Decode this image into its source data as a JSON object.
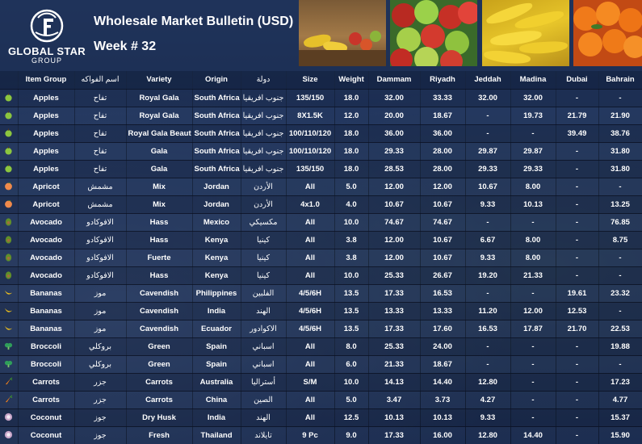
{
  "header": {
    "logo_name": "GLOBAL STAR",
    "logo_group": "GROUP",
    "title": "Wholesale Market Bulletin (USD)",
    "week": "Week # 32"
  },
  "columns": [
    "",
    "Item Group",
    "اسم الفواكه",
    "Variety",
    "Origin",
    "دولة",
    "Size",
    "Weight",
    "Dammam",
    "Riyadh",
    "Jeddah",
    "Madina",
    "Dubai",
    "Bahrain"
  ],
  "icon_colors": {
    "apple-icon": "#8cc63f",
    "apricot-icon": "#f08a4b",
    "avocado-icon": "#5f8f2a",
    "banana-icon": "#f2c21b",
    "broccoli-icon": "#2f9e5a",
    "carrot-icon": "#f07f1a",
    "coconut-icon": "#c9a6c9"
  },
  "rows": [
    {
      "icon": "apple-icon",
      "item": "Apples",
      "ar": "تفاح",
      "variety": "Royal Gala",
      "origin": "South Africa",
      "origin_ar": "جنوب افريقيا",
      "size": "135/150",
      "weight": "18.0",
      "dammam": "32.00",
      "riyadh": "33.33",
      "jeddah": "32.00",
      "madina": "32.00",
      "dubai": "-",
      "bahrain": "-"
    },
    {
      "icon": "apple-icon",
      "item": "Apples",
      "ar": "تفاح",
      "variety": "Royal Gala",
      "origin": "South Africa",
      "origin_ar": "جنوب افريقيا",
      "size": "8X1.5K",
      "weight": "12.0",
      "dammam": "20.00",
      "riyadh": "18.67",
      "jeddah": "-",
      "madina": "19.73",
      "dubai": "21.79",
      "bahrain": "21.90"
    },
    {
      "icon": "apple-icon",
      "item": "Apples",
      "ar": "تفاح",
      "variety": "Royal Gala Beaut",
      "origin": "South Africa",
      "origin_ar": "جنوب افريقيا",
      "size": "100/110/120",
      "weight": "18.0",
      "dammam": "36.00",
      "riyadh": "36.00",
      "jeddah": "-",
      "madina": "-",
      "dubai": "39.49",
      "bahrain": "38.76"
    },
    {
      "icon": "apple-icon",
      "item": "Apples",
      "ar": "تفاح",
      "variety": "Gala",
      "origin": "South Africa",
      "origin_ar": "جنوب افريقيا",
      "size": "100/110/120",
      "weight": "18.0",
      "dammam": "29.33",
      "riyadh": "28.00",
      "jeddah": "29.87",
      "madina": "29.87",
      "dubai": "-",
      "bahrain": "31.80"
    },
    {
      "icon": "apple-icon",
      "item": "Apples",
      "ar": "تفاح",
      "variety": "Gala",
      "origin": "South Africa",
      "origin_ar": "جنوب افريقيا",
      "size": "135/150",
      "weight": "18.0",
      "dammam": "28.53",
      "riyadh": "28.00",
      "jeddah": "29.33",
      "madina": "29.33",
      "dubai": "-",
      "bahrain": "31.80"
    },
    {
      "icon": "apricot-icon",
      "item": "Apricot",
      "ar": "مشمش",
      "variety": "Mix",
      "origin": "Jordan",
      "origin_ar": "الأردن",
      "size": "All",
      "weight": "5.0",
      "dammam": "12.00",
      "riyadh": "12.00",
      "jeddah": "10.67",
      "madina": "8.00",
      "dubai": "-",
      "bahrain": "-"
    },
    {
      "icon": "apricot-icon",
      "item": "Apricot",
      "ar": "مشمش",
      "variety": "Mix",
      "origin": "Jordan",
      "origin_ar": "الأردن",
      "size": "4x1.0",
      "weight": "4.0",
      "dammam": "10.67",
      "riyadh": "10.67",
      "jeddah": "9.33",
      "madina": "10.13",
      "dubai": "-",
      "bahrain": "13.25"
    },
    {
      "icon": "avocado-icon",
      "item": "Avocado",
      "ar": "الافوكادو",
      "variety": "Hass",
      "origin": "Mexico",
      "origin_ar": "مكسيكي",
      "size": "All",
      "weight": "10.0",
      "dammam": "74.67",
      "riyadh": "74.67",
      "jeddah": "-",
      "madina": "-",
      "dubai": "-",
      "bahrain": "76.85"
    },
    {
      "icon": "avocado-icon",
      "item": "Avocado",
      "ar": "الافوكادو",
      "variety": "Hass",
      "origin": "Kenya",
      "origin_ar": "كينيا",
      "size": "All",
      "weight": "3.8",
      "dammam": "12.00",
      "riyadh": "10.67",
      "jeddah": "6.67",
      "madina": "8.00",
      "dubai": "-",
      "bahrain": "8.75"
    },
    {
      "icon": "avocado-icon",
      "item": "Avocado",
      "ar": "الافوكادو",
      "variety": "Fuerte",
      "origin": "Kenya",
      "origin_ar": "كينيا",
      "size": "All",
      "weight": "3.8",
      "dammam": "12.00",
      "riyadh": "10.67",
      "jeddah": "9.33",
      "madina": "8.00",
      "dubai": "-",
      "bahrain": "-"
    },
    {
      "icon": "avocado-icon",
      "item": "Avocado",
      "ar": "الافوكادو",
      "variety": "Hass",
      "origin": "Kenya",
      "origin_ar": "كينيا",
      "size": "All",
      "weight": "10.0",
      "dammam": "25.33",
      "riyadh": "26.67",
      "jeddah": "19.20",
      "madina": "21.33",
      "dubai": "-",
      "bahrain": "-"
    },
    {
      "icon": "banana-icon",
      "item": "Bananas",
      "ar": "موز",
      "variety": "Cavendish",
      "origin": "Philippines",
      "origin_ar": "الفلبين",
      "size": "4/5/6H",
      "weight": "13.5",
      "dammam": "17.33",
      "riyadh": "16.53",
      "jeddah": "-",
      "madina": "-",
      "dubai": "19.61",
      "bahrain": "23.32"
    },
    {
      "icon": "banana-icon",
      "item": "Bananas",
      "ar": "موز",
      "variety": "Cavendish",
      "origin": "India",
      "origin_ar": "الهند",
      "size": "4/5/6H",
      "weight": "13.5",
      "dammam": "13.33",
      "riyadh": "13.33",
      "jeddah": "11.20",
      "madina": "12.00",
      "dubai": "12.53",
      "bahrain": "-"
    },
    {
      "icon": "banana-icon",
      "item": "Bananas",
      "ar": "موز",
      "variety": "Cavendish",
      "origin": "Ecuador",
      "origin_ar": "الاكوادور",
      "size": "4/5/6H",
      "weight": "13.5",
      "dammam": "17.33",
      "riyadh": "17.60",
      "jeddah": "16.53",
      "madina": "17.87",
      "dubai": "21.70",
      "bahrain": "22.53"
    },
    {
      "icon": "broccoli-icon",
      "item": "Broccoli",
      "ar": "بروكلي",
      "variety": "Green",
      "origin": "Spain",
      "origin_ar": "اسباني",
      "size": "All",
      "weight": "8.0",
      "dammam": "25.33",
      "riyadh": "24.00",
      "jeddah": "-",
      "madina": "-",
      "dubai": "-",
      "bahrain": "19.88"
    },
    {
      "icon": "broccoli-icon",
      "item": "Broccoli",
      "ar": "بروكلي",
      "variety": "Green",
      "origin": "Spain",
      "origin_ar": "اسباني",
      "size": "All",
      "weight": "6.0",
      "dammam": "21.33",
      "riyadh": "18.67",
      "jeddah": "-",
      "madina": "-",
      "dubai": "-",
      "bahrain": "-"
    },
    {
      "icon": "carrot-icon",
      "item": "Carrots",
      "ar": "جزر",
      "variety": "Carrots",
      "origin": "Australia",
      "origin_ar": "أستراليا",
      "size": "S/M",
      "weight": "10.0",
      "dammam": "14.13",
      "riyadh": "14.40",
      "jeddah": "12.80",
      "madina": "-",
      "dubai": "-",
      "bahrain": "17.23"
    },
    {
      "icon": "carrot-icon",
      "item": "Carrots",
      "ar": "جزر",
      "variety": "Carrots",
      "origin": "China",
      "origin_ar": "الصين",
      "size": "All",
      "weight": "5.0",
      "dammam": "3.47",
      "riyadh": "3.73",
      "jeddah": "4.27",
      "madina": "-",
      "dubai": "-",
      "bahrain": "4.77"
    },
    {
      "icon": "coconut-icon",
      "item": "Coconut",
      "ar": "جوز",
      "variety": "Dry Husk",
      "origin": "India",
      "origin_ar": "الهند",
      "size": "All",
      "weight": "12.5",
      "dammam": "10.13",
      "riyadh": "10.13",
      "jeddah": "9.33",
      "madina": "-",
      "dubai": "-",
      "bahrain": "15.37"
    },
    {
      "icon": "coconut-icon",
      "item": "Coconut",
      "ar": "جوز",
      "variety": "Fresh",
      "origin": "Thailand",
      "origin_ar": "تايلاند",
      "size": "9 Pc",
      "weight": "9.0",
      "dammam": "17.33",
      "riyadh": "16.00",
      "jeddah": "12.80",
      "madina": "14.40",
      "dubai": "-",
      "bahrain": "15.90"
    }
  ]
}
